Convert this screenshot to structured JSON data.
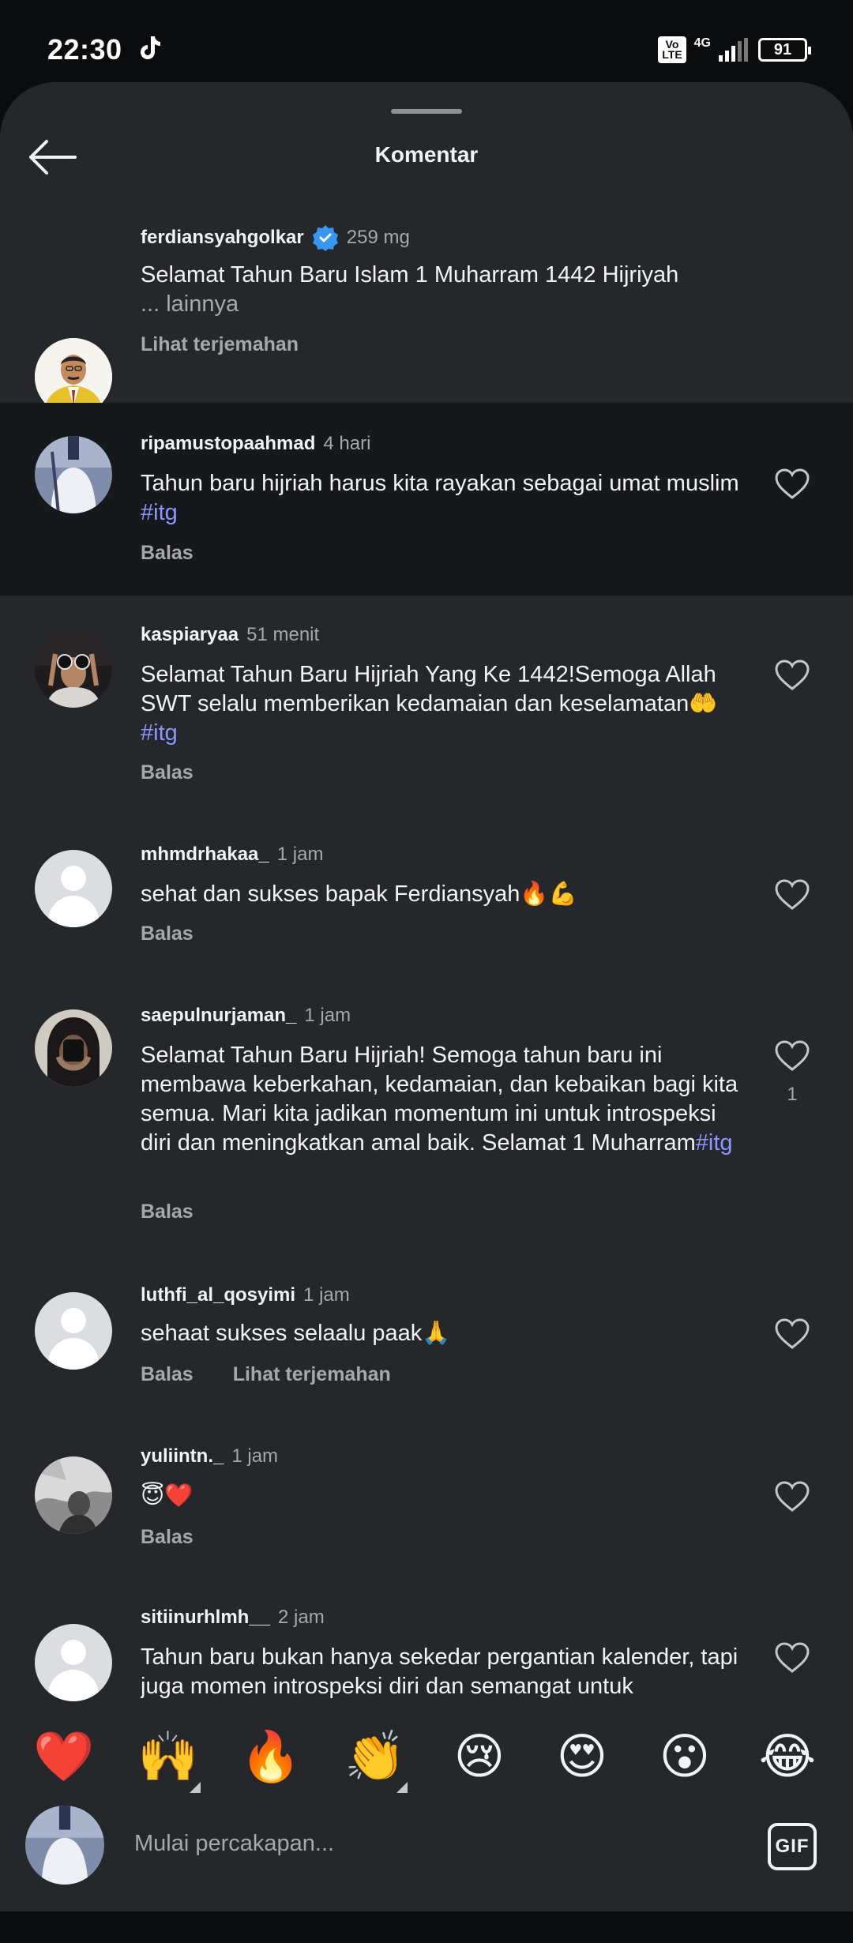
{
  "status": {
    "time": "22:30",
    "volte": "Vo LTE",
    "network": "4G",
    "battery": "91"
  },
  "header": {
    "title": "Komentar",
    "back_icon": "back-arrow-icon"
  },
  "caption": {
    "username": "ferdiansyahgolkar",
    "verified": true,
    "time": "259 mg",
    "text": "Selamat Tahun Baru Islam 1 Muharram 1442 Hijriyah",
    "more": "... lainnya",
    "translate": "Lihat terjemahan"
  },
  "comments": [
    {
      "username": "ripamustopaahmad",
      "time": "4 hari",
      "text": "Tahun baru hijriah harus kita rayakan sebagai umat muslim ",
      "tag": "#itg",
      "reply": "Balas"
    },
    {
      "username": "kaspiaryaa",
      "time": "51 menit",
      "text": "Selamat Tahun Baru Hijriah Yang Ke 1442!Semoga Allah SWT selalu memberikan kedamaian dan keselamatan🤲 ",
      "tag": "#itg",
      "reply": "Balas"
    },
    {
      "username": "mhmdrhakaa_",
      "time": "1 jam",
      "text": "sehat dan sukses bapak Ferdiansyah🔥💪",
      "reply": "Balas"
    },
    {
      "username": "saepulnurjaman_",
      "time": "1 jam",
      "text": "Selamat Tahun Baru Hijriah! Semoga tahun baru ini membawa keberkahan, kedamaian, dan kebaikan bagi kita semua. Mari kita jadikan momentum ini untuk introspeksi diri dan meningkatkan amal baik. Selamat 1 Muharram",
      "tag": "#itg",
      "reply": "Balas",
      "likes": "1"
    },
    {
      "username": "luthfi_al_qosyimi",
      "time": "1 jam",
      "text": "sehaat sukses selaalu paak🙏",
      "reply": "Balas",
      "translate": "Lihat terjemahan"
    },
    {
      "username": "yuliintn._",
      "time": "1 jam",
      "text": "😇❤️",
      "reply": "Balas"
    },
    {
      "username": "sitiinurhlmh__",
      "time": "2 jam",
      "text": "Tahun baru bukan hanya sekedar pergantian kalender, tapi juga momen introspeksi diri dan semangat untuk"
    }
  ],
  "emojis": [
    "❤️",
    "🙌",
    "🔥",
    "👏",
    "😢",
    "😍",
    "😮",
    "😂"
  ],
  "input": {
    "placeholder": "Mulai percakapan...",
    "gif_label": "GIF"
  },
  "colors": {
    "sheet": "#25272b",
    "highlight_row": "#17181a",
    "hashtag": "#8a97ff",
    "verified": "#3897f0"
  }
}
